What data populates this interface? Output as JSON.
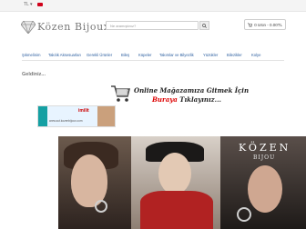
{
  "topbar": {
    "language": "TL ▾"
  },
  "brand": {
    "logo_text": "Közen Bijoux"
  },
  "search": {
    "placeholder": "Ne aramıştınız?"
  },
  "cart": {
    "label": "0 ürün - 0.00TL"
  },
  "nav": {
    "items": [
      "Şıkmelinim",
      "Takılık Aksesuarları",
      "Gerekli Ürünler",
      "Bileş",
      "Küpeler",
      "Takımlar ve Bilyezlik",
      "Yüzükler",
      "Bilezikler",
      "Kolye"
    ]
  },
  "content": {
    "welcome": "Geldiniz...",
    "promo_line1": "Online Mağazamıza Gitmek İçin",
    "promo_red": "Buraya",
    "promo_rest": " Tıklayınız...",
    "ad_word": "imilit",
    "ad_small": "www.sut.kozenbijoux.com"
  },
  "hero": {
    "brand_text": "KÖZEN",
    "brand_sub": "BIJOU"
  }
}
